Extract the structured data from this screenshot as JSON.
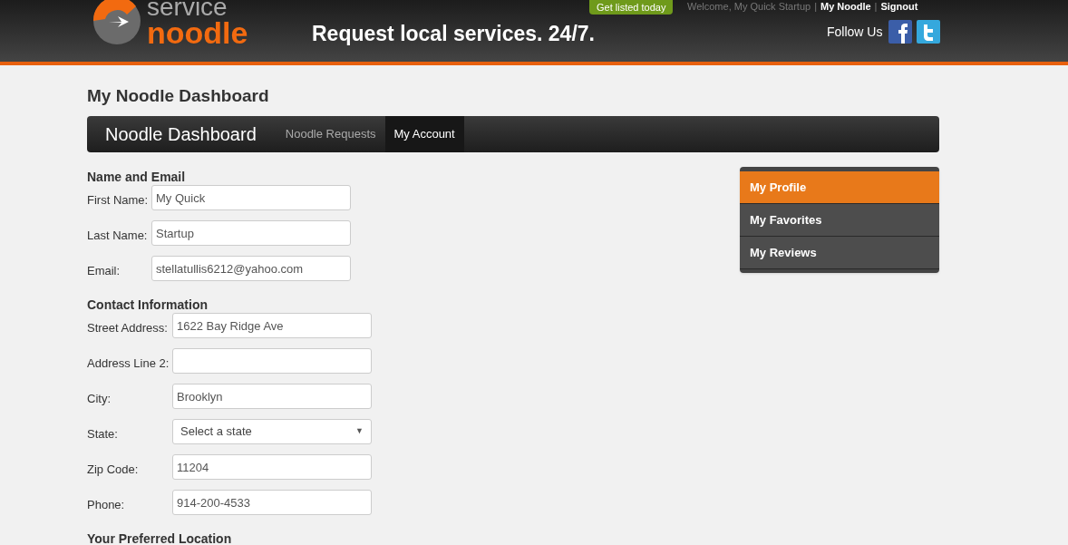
{
  "header": {
    "logo": {
      "top": "service",
      "bottom": "noodle"
    },
    "tagline": "Request local services. 24/7.",
    "cta": "Get listed today",
    "welcome": "Welcome, My Quick Startup",
    "links": [
      "My Noodle",
      "Signout"
    ],
    "separators": [
      "|",
      "|"
    ],
    "follow": "Follow Us"
  },
  "page_title": "My Noodle Dashboard",
  "nav": {
    "title": "Noodle Dashboard",
    "tabs": [
      {
        "label": "Noodle Requests",
        "selected": false
      },
      {
        "label": "My Account",
        "selected": true
      }
    ]
  },
  "sections": [
    {
      "title": "Name and Email",
      "fields": [
        {
          "label": "First Name:",
          "kind": "text",
          "value": "My Quick"
        },
        {
          "label": "Last Name:",
          "kind": "text",
          "value": "Startup"
        },
        {
          "label": "Email:",
          "kind": "text",
          "value": "stellatullis6212@yahoo.com"
        }
      ]
    },
    {
      "title": "Contact Information",
      "fields": [
        {
          "label": "Street Address:",
          "kind": "text",
          "value": "1622 Bay Ridge Ave"
        },
        {
          "label": "Address Line 2:",
          "kind": "text"
        },
        {
          "label": "City:",
          "kind": "text",
          "value": "Brooklyn"
        },
        {
          "label": "State:",
          "kind": "select",
          "value": "Select a state",
          "arrow": "▼"
        },
        {
          "label": "Zip Code:",
          "kind": "text",
          "value": "11204"
        },
        {
          "label": "Phone:",
          "kind": "text",
          "value": "914-200-4533"
        }
      ]
    },
    {
      "title": "Your Preferred Location"
    }
  ],
  "side_menu": [
    {
      "label": "My Profile",
      "selected": true
    },
    {
      "label": "My Favorites",
      "selected": false
    },
    {
      "label": "My Reviews",
      "selected": false
    }
  ]
}
